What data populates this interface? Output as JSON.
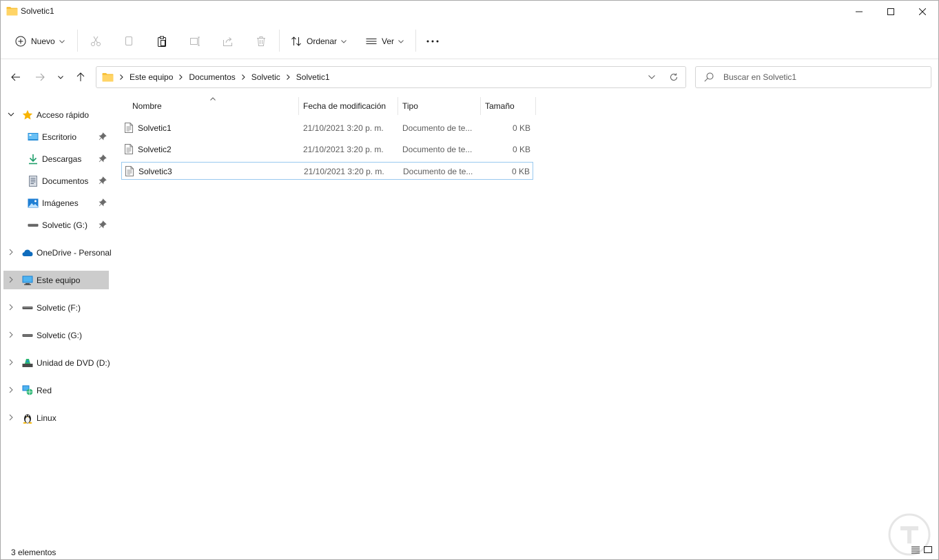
{
  "window": {
    "title": "Solvetic1"
  },
  "toolbar": {
    "new_label": "Nuevo",
    "sort_label": "Ordenar",
    "view_label": "Ver"
  },
  "address": {
    "crumbs": [
      "Este equipo",
      "Documentos",
      "Solvetic",
      "Solvetic1"
    ]
  },
  "search": {
    "placeholder": "Buscar en Solvetic1"
  },
  "sidebar": {
    "quick_access": "Acceso rápido",
    "quick_items": [
      {
        "label": "Escritorio",
        "icon": "desktop-icon"
      },
      {
        "label": "Descargas",
        "icon": "download-icon"
      },
      {
        "label": "Documentos",
        "icon": "documents-icon"
      },
      {
        "label": "Imágenes",
        "icon": "pictures-icon"
      },
      {
        "label": "Solvetic (G:)",
        "icon": "drive-icon"
      }
    ],
    "roots": [
      {
        "label": "OneDrive - Personal",
        "icon": "onedrive-icon"
      },
      {
        "label": "Este equipo",
        "icon": "computer-icon",
        "selected": true
      },
      {
        "label": "Solvetic (F:)",
        "icon": "drive-icon"
      },
      {
        "label": "Solvetic (G:)",
        "icon": "drive-icon"
      },
      {
        "label": "Unidad de DVD (D:)",
        "icon": "dvd-icon"
      },
      {
        "label": "Red",
        "icon": "network-icon"
      },
      {
        "label": "Linux",
        "icon": "linux-icon"
      }
    ]
  },
  "columns": {
    "name": "Nombre",
    "date": "Fecha de modificación",
    "type": "Tipo",
    "size": "Tamaño"
  },
  "files": [
    {
      "name": "Solvetic1",
      "date": "21/10/2021 3:20 p. m.",
      "type": "Documento de te...",
      "size": "0 KB"
    },
    {
      "name": "Solvetic2",
      "date": "21/10/2021 3:20 p. m.",
      "type": "Documento de te...",
      "size": "0 KB"
    },
    {
      "name": "Solvetic3",
      "date": "21/10/2021 3:20 p. m.",
      "type": "Documento de te...",
      "size": "0 KB",
      "selected": true
    }
  ],
  "status": {
    "count": "3 elementos"
  },
  "colors": {
    "accent": "#0067c0",
    "folder": "#f8c13a",
    "selection": "#cccccc",
    "row_selected_border": "#99c9ef"
  }
}
